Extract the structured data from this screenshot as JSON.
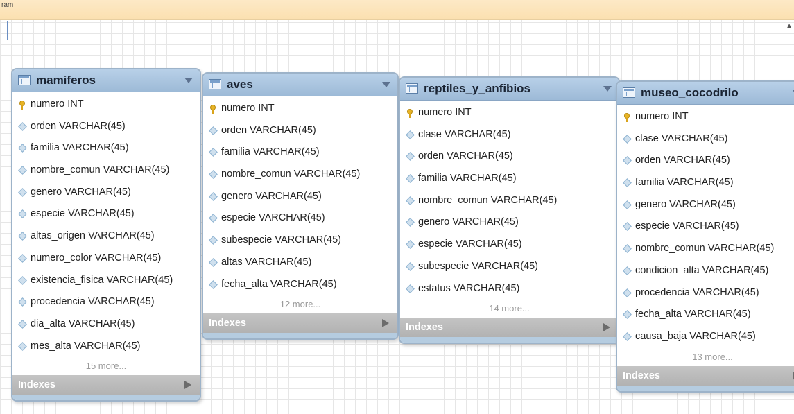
{
  "window": {
    "title_fragment": "ram"
  },
  "tables": [
    {
      "name": "mamiferos",
      "columns": [
        {
          "label": "numero INT",
          "key": true
        },
        {
          "label": "orden VARCHAR(45)",
          "key": false
        },
        {
          "label": "familia VARCHAR(45)",
          "key": false
        },
        {
          "label": "nombre_comun VARCHAR(45)",
          "key": false
        },
        {
          "label": "genero VARCHAR(45)",
          "key": false
        },
        {
          "label": "especie VARCHAR(45)",
          "key": false
        },
        {
          "label": "altas_origen VARCHAR(45)",
          "key": false
        },
        {
          "label": "numero_color VARCHAR(45)",
          "key": false
        },
        {
          "label": "existencia_fisica VARCHAR(45)",
          "key": false
        },
        {
          "label": "procedencia VARCHAR(45)",
          "key": false
        },
        {
          "label": "dia_alta VARCHAR(45)",
          "key": false
        },
        {
          "label": "mes_alta VARCHAR(45)",
          "key": false
        }
      ],
      "more": "15 more...",
      "indexes_label": "Indexes"
    },
    {
      "name": "aves",
      "columns": [
        {
          "label": "numero INT",
          "key": true
        },
        {
          "label": "orden VARCHAR(45)",
          "key": false
        },
        {
          "label": "familia VARCHAR(45)",
          "key": false
        },
        {
          "label": "nombre_comun VARCHAR(45)",
          "key": false
        },
        {
          "label": "genero VARCHAR(45)",
          "key": false
        },
        {
          "label": "especie VARCHAR(45)",
          "key": false
        },
        {
          "label": "subespecie VARCHAR(45)",
          "key": false
        },
        {
          "label": "altas VARCHAR(45)",
          "key": false
        },
        {
          "label": "fecha_alta VARCHAR(45)",
          "key": false
        }
      ],
      "more": "12 more...",
      "indexes_label": "Indexes"
    },
    {
      "name": "reptiles_y_anfibios",
      "columns": [
        {
          "label": "numero INT",
          "key": true
        },
        {
          "label": "clase VARCHAR(45)",
          "key": false
        },
        {
          "label": "orden VARCHAR(45)",
          "key": false
        },
        {
          "label": "familia VARCHAR(45)",
          "key": false
        },
        {
          "label": "nombre_comun VARCHAR(45)",
          "key": false
        },
        {
          "label": "genero VARCHAR(45)",
          "key": false
        },
        {
          "label": "especie VARCHAR(45)",
          "key": false
        },
        {
          "label": "subespecie VARCHAR(45)",
          "key": false
        },
        {
          "label": "estatus VARCHAR(45)",
          "key": false
        }
      ],
      "more": "14 more...",
      "indexes_label": "Indexes"
    },
    {
      "name": "museo_cocodrilo",
      "columns": [
        {
          "label": "numero INT",
          "key": true
        },
        {
          "label": "clase VARCHAR(45)",
          "key": false
        },
        {
          "label": "orden VARCHAR(45)",
          "key": false
        },
        {
          "label": "familia VARCHAR(45)",
          "key": false
        },
        {
          "label": "genero VARCHAR(45)",
          "key": false
        },
        {
          "label": "especie VARCHAR(45)",
          "key": false
        },
        {
          "label": "nombre_comun VARCHAR(45)",
          "key": false
        },
        {
          "label": "condicion_alta VARCHAR(45)",
          "key": false
        },
        {
          "label": "procedencia VARCHAR(45)",
          "key": false
        },
        {
          "label": "fecha_alta VARCHAR(45)",
          "key": false
        },
        {
          "label": "causa_baja VARCHAR(45)",
          "key": false
        }
      ],
      "more": "13 more...",
      "indexes_label": "Indexes"
    }
  ]
}
